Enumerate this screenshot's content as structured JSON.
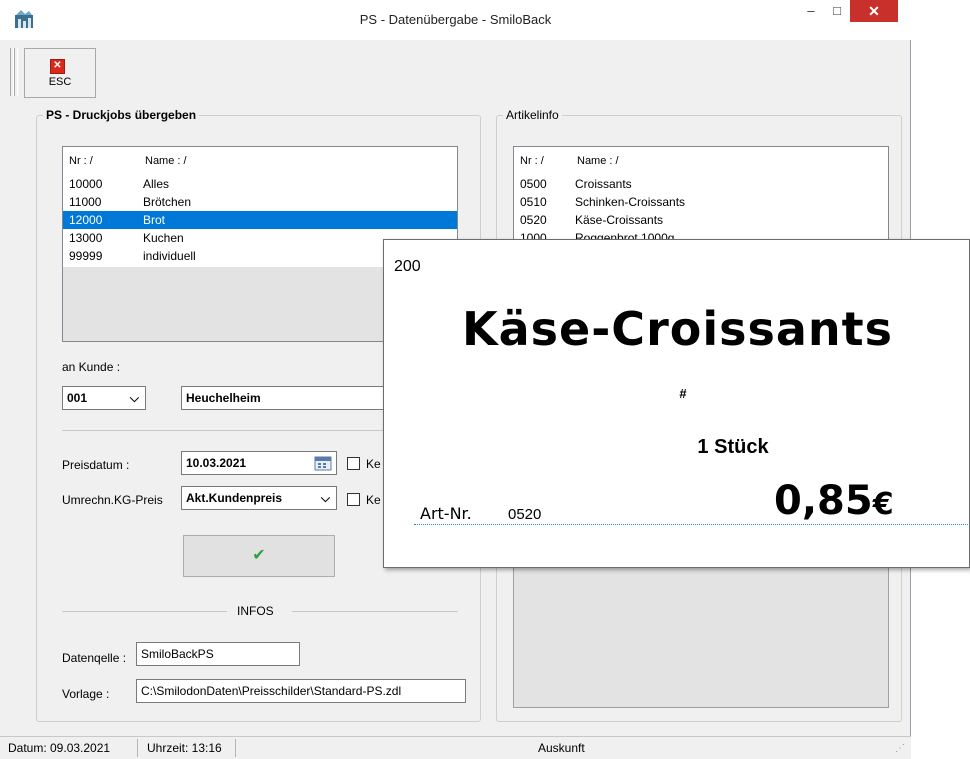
{
  "window": {
    "title": "PS - Datenübergabe - SmiloBack",
    "min_glyph": "–",
    "max_glyph": "□",
    "close_glyph": "✕"
  },
  "toolbar": {
    "esc_label": "ESC",
    "esc_icon_glyph": "✕"
  },
  "left_group": {
    "title": "PS - Druckjobs übergeben",
    "list_headers": [
      "Nr :  /",
      "Name :  /"
    ],
    "rows": [
      {
        "nr": "10000",
        "name": "Alles",
        "selected": false
      },
      {
        "nr": "11000",
        "name": "Brötchen",
        "selected": false
      },
      {
        "nr": "12000",
        "name": "Brot",
        "selected": true
      },
      {
        "nr": "13000",
        "name": "Kuchen",
        "selected": false
      },
      {
        "nr": "99999",
        "name": "individuell",
        "selected": false
      }
    ],
    "kunde_label": "an Kunde :",
    "kunde_code": "001",
    "kunde_name": "Heuchelheim",
    "preisdatum_label": "Preisdatum :",
    "preisdatum_value": "10.03.2021",
    "umrechn_label": "Umrechn.KG-Preis",
    "umrechn_value": "Akt.Kundenpreis",
    "checkbox1_label_partial": "Ke",
    "checkbox2_label_partial": "Ke",
    "ok_glyph": "✔",
    "infos_label": "INFOS",
    "datenquelle_label": "Datenqelle :",
    "datenquelle_value": "SmiloBackPS",
    "vorlage_label": "Vorlage :",
    "vorlage_value": "C:\\SmilodonDaten\\Preisschilder\\Standard-PS.zdl"
  },
  "right_group": {
    "title": "Artikelinfo",
    "list_headers": [
      "Nr :  /",
      "Name :  /"
    ],
    "rows": [
      {
        "nr": "0500",
        "name": "Croissants"
      },
      {
        "nr": "0510",
        "name": "Schinken-Croissants"
      },
      {
        "nr": "0520",
        "name": "Käse-Croissants"
      },
      {
        "nr": "1000",
        "name": "Roggenbrot 1000g"
      }
    ]
  },
  "price_label": {
    "top_number": "200",
    "product_name": "Käse-Croissants",
    "hash": "#",
    "quantity": "1 Stück",
    "art_nr_label": "Art-Nr.",
    "art_nr_value": "0520",
    "price": "0,85",
    "currency": "€"
  },
  "status_bar": {
    "datum": "Datum: 09.03.2021",
    "uhrzeit": "Uhrzeit: 13:16",
    "auskunft": "Auskunft"
  },
  "colors": {
    "selection": "#0078d7",
    "close_button": "#c7302b",
    "ok_check": "#2ea043",
    "dotted_line": "#2f8fb0"
  }
}
